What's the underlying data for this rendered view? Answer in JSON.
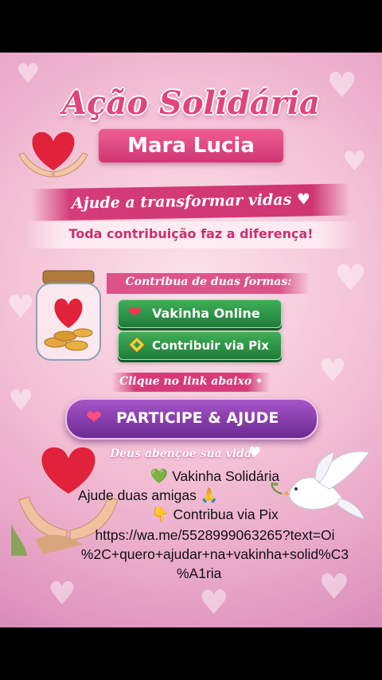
{
  "poster": {
    "title": "Ação Solidária",
    "name": "Mara Lucia",
    "banner_main": "Ajude a transformar vidas ♥",
    "banner_sub": "Toda contribuição faz a diferença!",
    "two_ways": "Contribua de duas formas:",
    "button_vakinha": "Vakinha Online",
    "button_pix": "Contribuir via Pix",
    "click_below": "Clique no link abaixo •",
    "participate": "PARTICIPE & AJUDE",
    "blessing": "Deus abençoe sua vida!"
  },
  "caption": {
    "line1_emoji": "💚",
    "line1": "Vakinha Solidária",
    "line2": "Ajude duas amigas",
    "line2_emoji": "🙏",
    "line3_emoji": "👇",
    "line3": "Contribua via Pix",
    "link_line1": "https://wa.me/5528999063265?text=Oi",
    "link_line2": "%2C+quero+ajudar+na+vakinha+solid%C3",
    "link_line3": "%A1ria"
  },
  "icons": {
    "heart": "heart-icon",
    "pix": "pix-icon",
    "jar": "jar-icon",
    "dove": "dove-icon",
    "hands": "hands-icon"
  },
  "colors": {
    "accent_pink": "#d43c78",
    "green_button": "#2e9a49",
    "purple_button": "#8a3fb0"
  }
}
